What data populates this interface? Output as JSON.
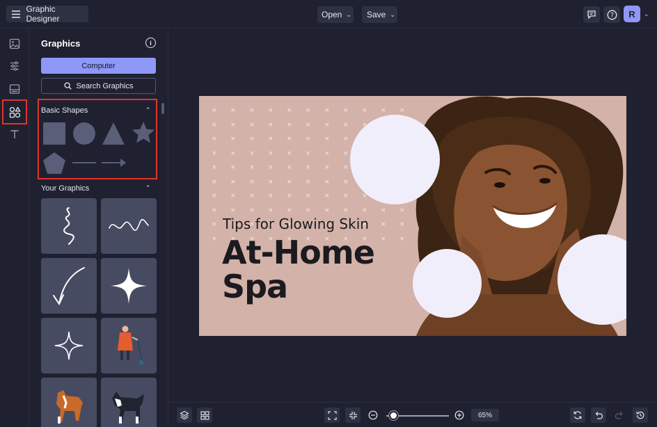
{
  "topbar": {
    "app_name": "Graphic Designer",
    "open_label": "Open",
    "save_label": "Save",
    "avatar_initial": "R"
  },
  "rail": {
    "items": [
      "image-icon",
      "adjustments-icon",
      "layout-icon",
      "graphics-icon",
      "text-icon"
    ],
    "active": "graphics-icon"
  },
  "panel": {
    "title": "Graphics",
    "computer_label": "Computer",
    "search_label": "Search Graphics",
    "basic_shapes_label": "Basic Shapes",
    "your_graphics_label": "Your Graphics",
    "shapes": [
      "square",
      "circle",
      "triangle",
      "star",
      "pentagon",
      "line",
      "arrow"
    ],
    "graphics": [
      "squiggle-vertical",
      "squiggle-horizontal",
      "curved-arrow",
      "sparkle",
      "sparkle-outline",
      "person-with-dog",
      "dog-boxer",
      "dog-husky"
    ]
  },
  "design": {
    "subtitle": "Tips for Glowing Skin",
    "headline_line1": "At-Home",
    "headline_line2": "Spa",
    "bg_color": "#d3b2a9",
    "circle_color": "#f1eefc"
  },
  "bottombar": {
    "zoom_label": "65%",
    "zoom_value": 0.65
  },
  "colors": {
    "accent": "#8f97f7",
    "highlight": "#e0352b",
    "bg": "#1f2130"
  }
}
